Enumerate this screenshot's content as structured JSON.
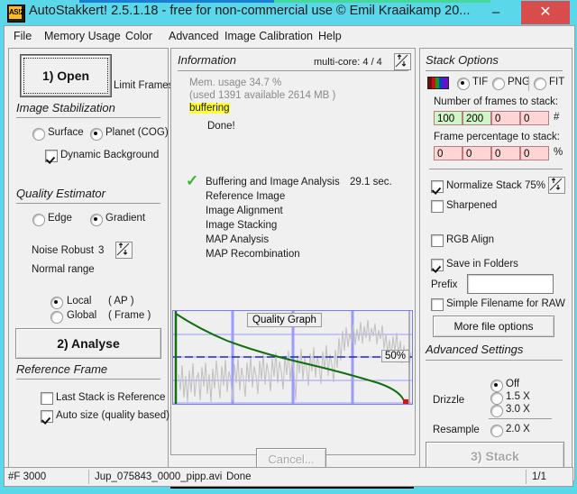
{
  "window": {
    "title": "AutoStakkert! 2.5.1.18 - free for non-commercial use © Emil Kraaikamp 20...",
    "app_icon_text": "AS!2",
    "minimize": "–",
    "maximize": "",
    "close": "✕",
    "border_color": "#5ad7e8"
  },
  "menu": {
    "items": [
      {
        "label": "File"
      },
      {
        "label": "Memory Usage"
      },
      {
        "label": "Color"
      },
      {
        "label": "Advanced"
      },
      {
        "label": "Image Calibration"
      },
      {
        "label": "Help"
      }
    ]
  },
  "left_panel": {
    "open_button": "1) Open",
    "limit_frames": "Limit Frames",
    "image_stabilization": {
      "caption": "Image Stabilization",
      "surface": "Surface",
      "planet": "Planet (COG)",
      "selected": "Planet (COG)",
      "dynamic_background": "Dynamic Background",
      "dynamic_background_checked": true
    },
    "quality_estimator": {
      "caption": "Quality Estimator",
      "edge": "Edge",
      "gradient": "Gradient",
      "selected": "Gradient",
      "noise_robust_label": "Noise Robust",
      "noise_robust_value": "3",
      "range_note": "Normal range",
      "local": "Local",
      "local_note": "( AP )",
      "global": "Global",
      "global_note": "( Frame )",
      "scope_selected": "Local"
    },
    "analyse_button": "2) Analyse",
    "reference_frame": {
      "caption": "Reference Frame",
      "last_stack_is_reference": "Last Stack is Reference",
      "last_stack_checked": false,
      "auto_size": "Auto size (quality based)",
      "auto_size_checked": true
    }
  },
  "information": {
    "caption": "Information",
    "multicore_label": "multi-core: 4 / 4",
    "mem_usage": "Mem. usage 34.7 %",
    "mem_detail": "(used 1391 available 2614 MB )",
    "buffering": "buffering",
    "done": "Done!",
    "steps": [
      {
        "label": "Buffering and Image Analysis",
        "time": "29.1 sec.",
        "done": true
      },
      {
        "label": "Reference Image",
        "time": "",
        "done": false
      },
      {
        "label": "Image Alignment",
        "time": "",
        "done": false
      },
      {
        "label": "Image Stacking",
        "time": "",
        "done": false
      },
      {
        "label": "MAP Analysis",
        "time": "",
        "done": false
      },
      {
        "label": "MAP Recombination",
        "time": "",
        "done": false
      }
    ],
    "cancel_button": "Cancel...",
    "progress_top": "100%",
    "progress_bottom": "100%"
  },
  "chart_data": {
    "type": "line",
    "title": "Quality Graph",
    "xlabel": "",
    "ylabel": "",
    "annotation": "50%",
    "threshold_percent": 50,
    "ylim": [
      0,
      100
    ],
    "xlim": [
      0,
      3000
    ],
    "grid": true,
    "gridlines_x": [
      0,
      600,
      1200,
      1800,
      2400,
      3000
    ],
    "gridlines_y": [
      0,
      25,
      50,
      75,
      100
    ],
    "series": [
      {
        "name": "Sorted quality curve",
        "color": "#107010",
        "x": [
          0,
          150,
          300,
          450,
          600,
          750,
          900,
          1050,
          1200,
          1350,
          1500,
          1650,
          1800,
          1950,
          2100,
          2250,
          2400,
          2550,
          2700,
          2850,
          2940,
          2985,
          3000
        ],
        "values": [
          100,
          92,
          86,
          81,
          77,
          73,
          70,
          67,
          64,
          61,
          58,
          55,
          52,
          49,
          45,
          42,
          38,
          33,
          28,
          21,
          14,
          6,
          0
        ]
      },
      {
        "name": "Per-frame quality (unsorted)",
        "color": "#c0c0c0",
        "x": [
          0,
          100,
          200,
          300,
          400,
          500,
          600,
          700,
          800,
          900,
          1000,
          1100,
          1200,
          1300,
          1400,
          1500,
          1600,
          1700,
          1800,
          1900,
          2000,
          2100,
          2200,
          2300,
          2400,
          2500,
          2600,
          2700,
          2800,
          2900,
          3000
        ],
        "values": [
          30,
          22,
          35,
          28,
          40,
          33,
          45,
          38,
          42,
          47,
          40,
          50,
          44,
          52,
          47,
          55,
          50,
          58,
          54,
          62,
          70,
          75,
          82,
          78,
          85,
          80,
          74,
          68,
          62,
          66,
          55
        ]
      }
    ],
    "threshold_line": {
      "name": "50% threshold",
      "color": "#2222cc",
      "value": 50,
      "style": "dashed"
    },
    "end_marker": {
      "color": "#e01010",
      "x": 3000,
      "y": 0
    }
  },
  "stack_options": {
    "caption": "Stack Options",
    "formats": [
      {
        "label": "TIF",
        "selected": true
      },
      {
        "label": "PNG",
        "selected": false
      },
      {
        "label": "FIT",
        "selected": false
      }
    ],
    "frames_label": "Number of frames to stack:",
    "frames_values": [
      "100",
      "200",
      "0",
      "0"
    ],
    "frames_unit": "#",
    "percent_label": "Frame percentage to stack:",
    "percent_values": [
      "0",
      "0",
      "0",
      "0"
    ],
    "percent_unit": "%",
    "normalize_stack": "Normalize Stack",
    "normalize_value": "75%",
    "normalize_checked": true,
    "sharpened": "Sharpened",
    "sharpened_checked": false,
    "rgb_align": "RGB Align",
    "rgb_align_checked": false,
    "save_in_folders": "Save in Folders",
    "save_in_folders_checked": true,
    "prefix_label": "Prefix",
    "prefix_value": "",
    "simple_filename": "Simple Filename for RAW",
    "simple_filename_checked": false,
    "more_file_options": "More file options"
  },
  "advanced_settings": {
    "caption": "Advanced Settings",
    "drizzle_label": "Drizzle",
    "drizzle_options": [
      {
        "label": "Off",
        "selected": true
      },
      {
        "label": "1.5 X",
        "selected": false
      },
      {
        "label": "3.0 X",
        "selected": false
      }
    ],
    "resample_label": "Resample",
    "resample_options": [
      {
        "label": "2.0 X",
        "selected": false
      }
    ],
    "stack_button": "3) Stack"
  },
  "statusbar": {
    "frames": "#F 3000",
    "file": "Jup_075843_0000_pipp.avi",
    "state": "Done",
    "pages": "1/1"
  }
}
